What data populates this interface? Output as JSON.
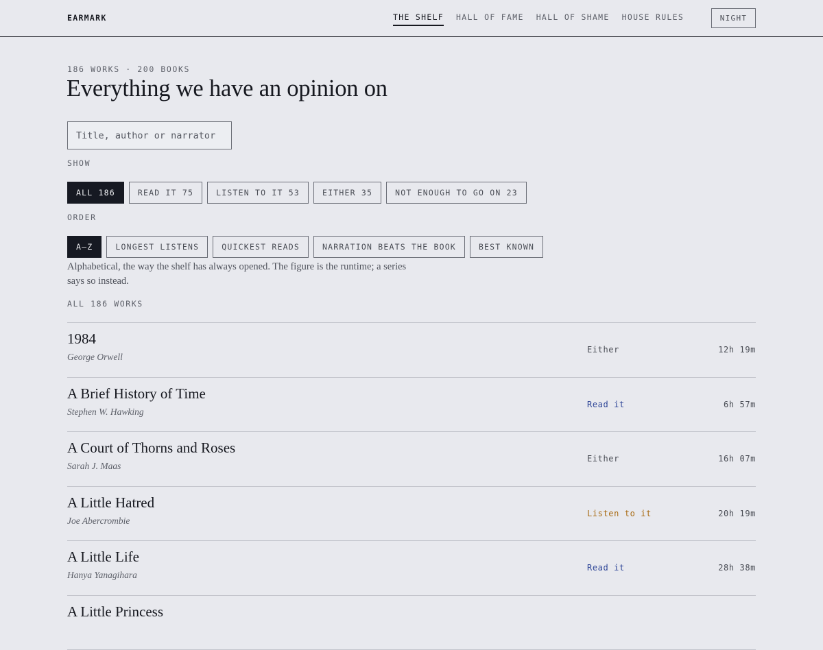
{
  "header": {
    "brand": "EARMARK",
    "nav": [
      {
        "label": "THE SHELF",
        "active": true
      },
      {
        "label": "HALL OF FAME",
        "active": false
      },
      {
        "label": "HALL OF SHAME",
        "active": false
      },
      {
        "label": "HOUSE RULES",
        "active": false
      }
    ],
    "night_label": "NIGHT"
  },
  "main": {
    "eyebrow": "186 WORKS · 200 BOOKS",
    "title": "Everything we have an opinion on",
    "search": {
      "placeholder": "Title, author or narrator",
      "value": ""
    },
    "show_label": "SHOW",
    "show_filters": [
      {
        "label": "ALL 186",
        "active": true
      },
      {
        "label": "READ IT 75",
        "active": false
      },
      {
        "label": "LISTEN TO IT 53",
        "active": false
      },
      {
        "label": "EITHER 35",
        "active": false
      },
      {
        "label": "NOT ENOUGH TO GO ON 23",
        "active": false
      }
    ],
    "order_label": "ORDER",
    "order_options": [
      {
        "label": "A–Z",
        "active": true
      },
      {
        "label": "LONGEST LISTENS",
        "active": false
      },
      {
        "label": "QUICKEST READS",
        "active": false
      },
      {
        "label": "NARRATION BEATS THE BOOK",
        "active": false
      },
      {
        "label": "BEST KNOWN",
        "active": false
      }
    ],
    "order_note": "Alphabetical, the way the shelf has always opened. The figure is the runtime; a series says so instead.",
    "count_label": "ALL 186 WORKS"
  },
  "works": [
    {
      "title": "1984",
      "author": "George Orwell",
      "verdict": "Either",
      "runtime": "12h 19m"
    },
    {
      "title": "A Brief History of Time",
      "author": "Stephen W. Hawking",
      "verdict": "Read it",
      "runtime": "6h 57m"
    },
    {
      "title": "A Court of Thorns and Roses",
      "author": "Sarah J. Maas",
      "verdict": "Either",
      "runtime": "16h 07m"
    },
    {
      "title": "A Little Hatred",
      "author": "Joe Abercrombie",
      "verdict": "Listen to it",
      "runtime": "20h 19m"
    },
    {
      "title": "A Little Life",
      "author": "Hanya Yanagihara",
      "verdict": "Read it",
      "runtime": "28h 38m"
    },
    {
      "title": "A Little Princess",
      "author": "",
      "verdict": "",
      "runtime": ""
    }
  ],
  "verdict_colors": {
    "Either": "#4a4d55",
    "Read it": "#2d4597",
    "Listen to it": "#a86a12"
  }
}
